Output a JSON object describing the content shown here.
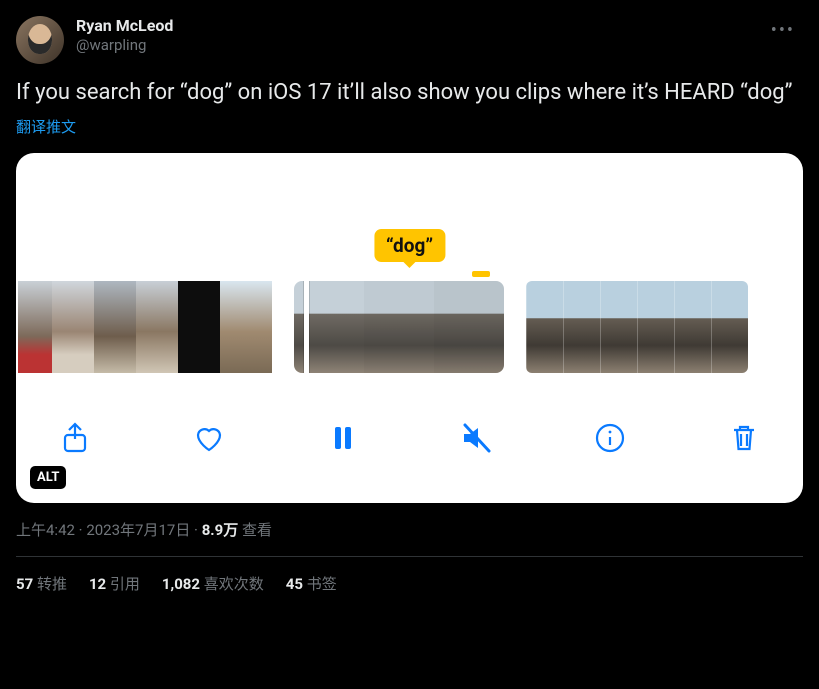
{
  "author": {
    "display_name": "Ryan McLeod",
    "handle": "@warpling"
  },
  "tweet_text": "If you search for “dog” on iOS 17 it’ll also show you clips where it’s HEARD “dog”",
  "translate_label": "翻译推文",
  "media": {
    "search_tag": "“dog”",
    "alt_badge": "ALT",
    "toolbar": {
      "share": "share",
      "like": "like",
      "pause": "pause",
      "mute": "mute",
      "info": "info",
      "trash": "delete"
    }
  },
  "meta": {
    "time": "上午4:42",
    "sep1": " · ",
    "date": "2023年7月17日",
    "sep2": " · ",
    "views_count": "8.9万",
    "views_label": " 查看"
  },
  "stats": {
    "retweets": {
      "count": "57",
      "label": " 转推"
    },
    "quotes": {
      "count": "12",
      "label": " 引用"
    },
    "likes": {
      "count": "1,082",
      "label": " 喜欢次数"
    },
    "bookmarks": {
      "count": "45",
      "label": " 书签"
    }
  }
}
